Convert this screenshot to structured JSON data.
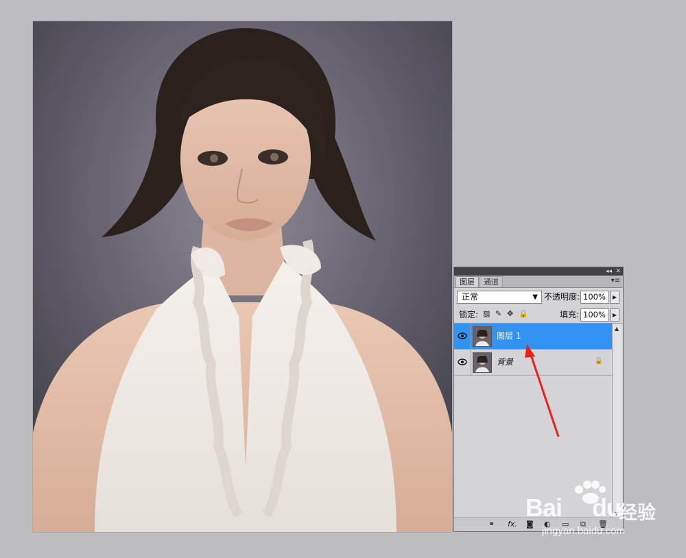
{
  "panel": {
    "tabs": [
      {
        "label": "图层",
        "active": true
      },
      {
        "label": "通道",
        "active": false
      }
    ],
    "blend_mode": "正常",
    "opacity_label": "不透明度:",
    "opacity_value": "100%",
    "lock_label": "锁定:",
    "fill_label": "填充:",
    "fill_value": "100%",
    "layers": [
      {
        "name": "图层 1",
        "selected": true,
        "visible": true
      },
      {
        "name": "背景",
        "selected": false,
        "visible": true,
        "locked": true
      }
    ]
  },
  "watermark": {
    "brand": "Bai",
    "brand2": "du",
    "suffix": "经验",
    "url": "jingyan.baidu.com"
  },
  "colors": {
    "selection": "#3393f3",
    "arrow": "#e8211c"
  }
}
